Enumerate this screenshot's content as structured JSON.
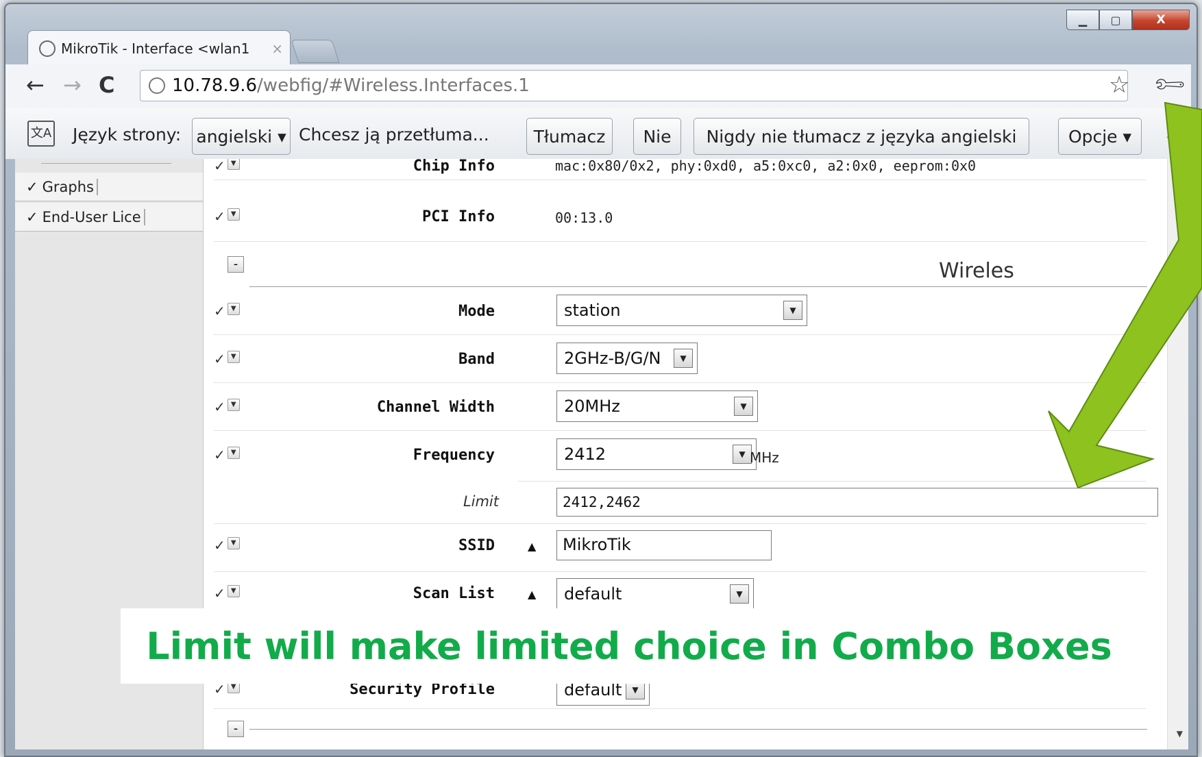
{
  "browser": {
    "tab_title": "MikroTik - Interface <wlan1",
    "tab_close": "×",
    "url_host": "10.78.9.6",
    "url_path": "/webfig/#Wireless.Interfaces.1",
    "window_controls": {
      "minimize": "▁",
      "maximize": "▢",
      "close": "X"
    }
  },
  "translate_bar": {
    "icon_text": "文A",
    "page_language_label": "Język strony:",
    "language_value": "angielski ▾",
    "question": "Chcesz ją przetłuma...",
    "translate_button": "Tłumacz",
    "no_button": "Nie",
    "never_button": "Nigdy nie tłumacz z języka angielski",
    "options_button": "Opcje ▾",
    "close": "×"
  },
  "sidebar": {
    "items": [
      {
        "label": "Graphs"
      },
      {
        "label": "End-User Lice"
      }
    ]
  },
  "form": {
    "chip_info": {
      "label": "Chip Info",
      "value": "mac:0x80/0x2, phy:0xd0, a5:0xc0, a2:0x0, eeprom:0x0"
    },
    "pci_info": {
      "label": "PCI Info",
      "value": "00:13.0"
    },
    "section_title": "Wireles",
    "mode": {
      "label": "Mode",
      "value": "station"
    },
    "band": {
      "label": "Band",
      "value": "2GHz-B/G/N"
    },
    "channel_width": {
      "label": "Channel Width",
      "value": "20MHz"
    },
    "frequency": {
      "label": "Frequency",
      "value": "2412",
      "unit": "MHz"
    },
    "limit": {
      "label": "Limit",
      "value": "2412,2462"
    },
    "ssid": {
      "label": "SSID",
      "value": "MikroTik"
    },
    "scan_list": {
      "label": "Scan List",
      "value": "default"
    },
    "security_profile": {
      "label": "Security Profile",
      "value": "default"
    }
  },
  "overlay": {
    "caption": "Limit will make limited choice in Combo Boxes",
    "arrow_color": "#8dc21f",
    "caption_color": "#12ab4a"
  }
}
